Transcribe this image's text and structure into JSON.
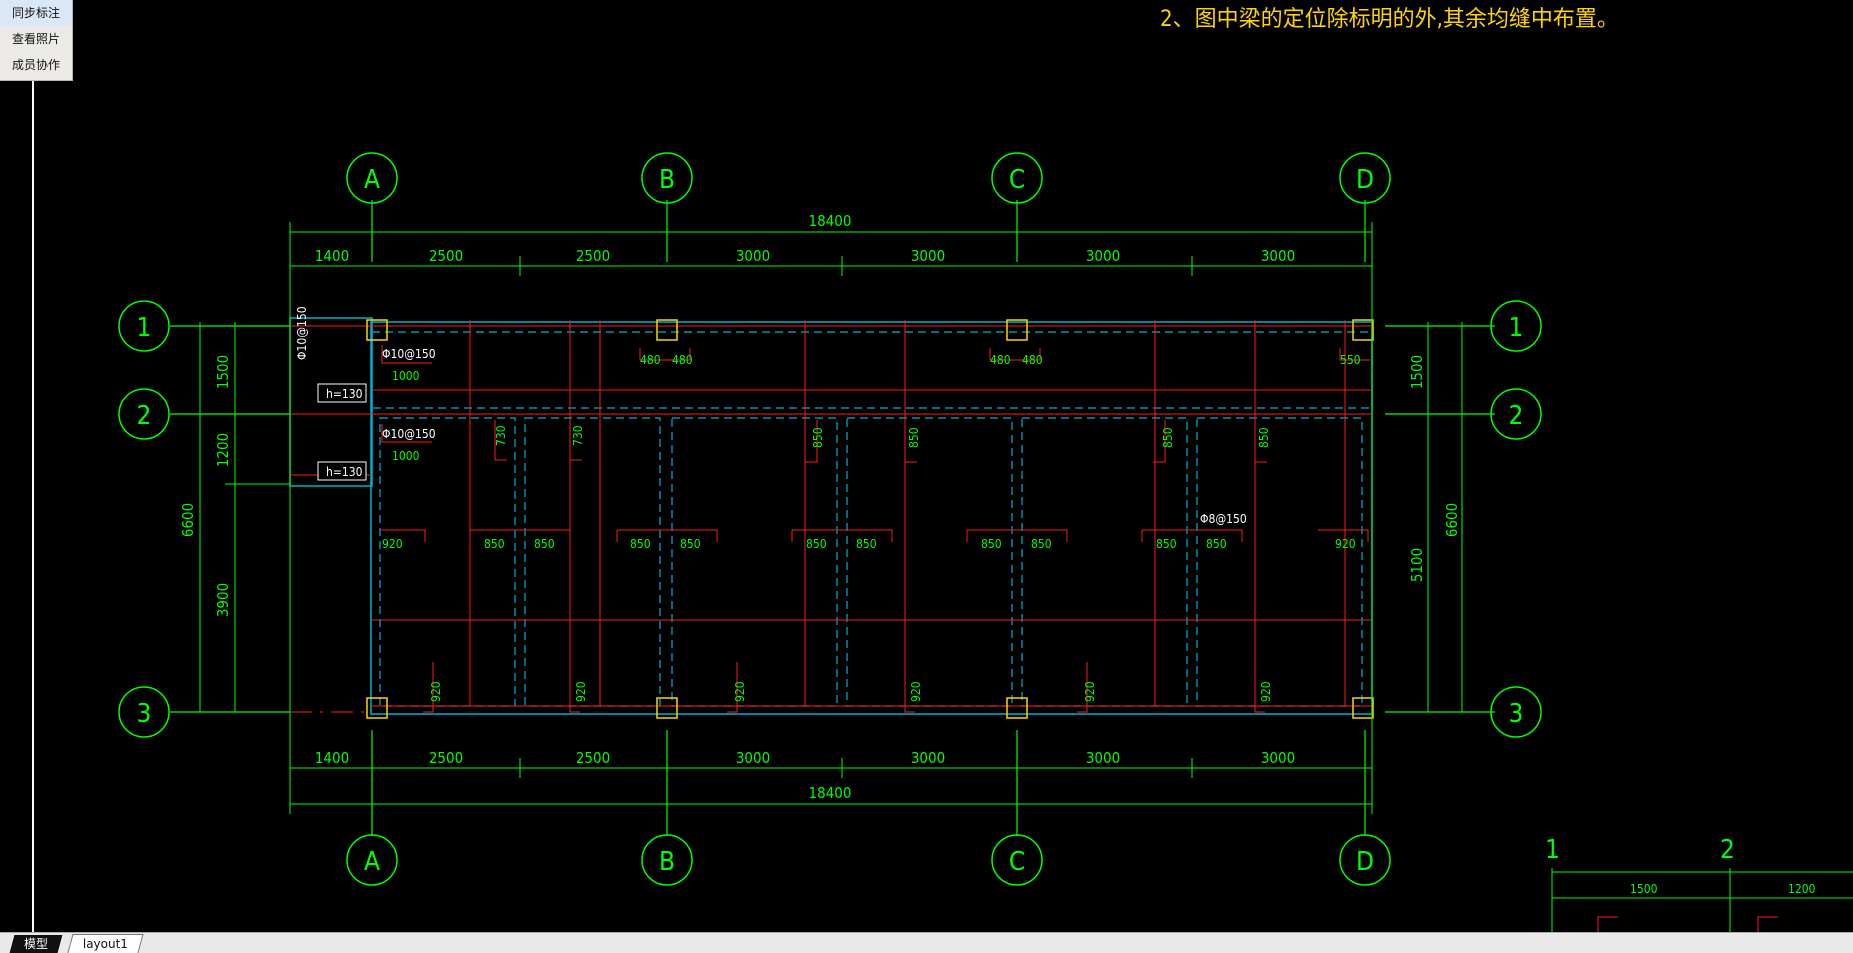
{
  "sidebar": {
    "buttons": [
      "同步标注",
      "查看照片",
      "成员协作"
    ]
  },
  "note": "2、图中梁的定位除标明的外,其余均缝中布置。",
  "axes": {
    "columns": [
      "A",
      "B",
      "C",
      "D"
    ],
    "rows": [
      "1",
      "2",
      "3"
    ]
  },
  "dims": {
    "total": "18400",
    "spans": [
      "1400",
      "2500",
      "2500",
      "3000",
      "3000",
      "3000",
      "3000"
    ],
    "left_spans": [
      "1500",
      "1200",
      "3900"
    ],
    "left_total": "6600",
    "right_spans": [
      "1500",
      "5100"
    ],
    "right_total": "6600"
  },
  "labels": {
    "rebar_top": "Φ10@150",
    "rebar_mid": "Φ10@150",
    "rebar_vert": "Φ10@150",
    "rebar_right": "Φ8@150",
    "h1": "h=130",
    "h2": "h=130",
    "len_1000_a": "1000",
    "len_1000_b": "1000",
    "top_480": "480",
    "top_550": "550",
    "l730": "730",
    "l850": "850",
    "l920": "920"
  },
  "corner_detail": {
    "axis_1": "1",
    "axis_2": "2",
    "d1": "1500",
    "d2": "1200"
  },
  "tabs": [
    "模型",
    "layout1"
  ],
  "colors": {
    "green": "#00ff00",
    "red": "#ff1a1a",
    "cyan": "#00b0d0",
    "yellow": "#ffd400",
    "white": "#ffffff"
  }
}
